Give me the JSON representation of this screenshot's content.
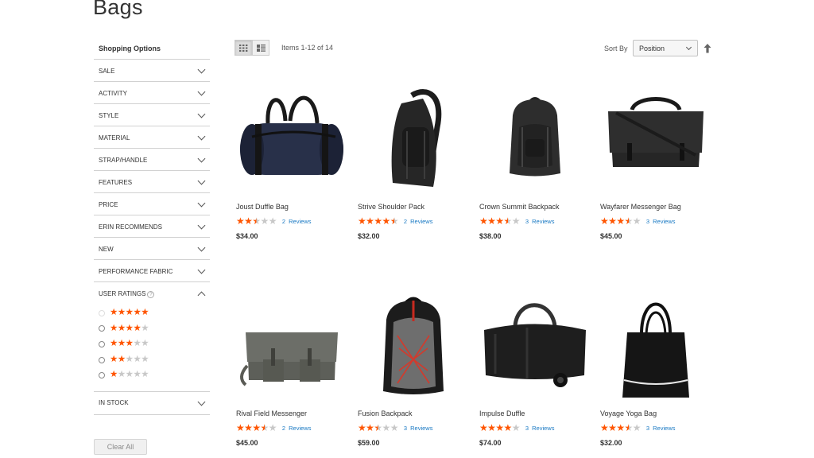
{
  "page": {
    "title": "Bags"
  },
  "sidebar": {
    "heading": "Shopping Options",
    "filters": [
      {
        "label": "SALE"
      },
      {
        "label": "ACTIVITY"
      },
      {
        "label": "STYLE"
      },
      {
        "label": "MATERIAL"
      },
      {
        "label": "STRAP/HANDLE"
      },
      {
        "label": "FEATURES"
      },
      {
        "label": "PRICE"
      },
      {
        "label": "ERIN RECOMMENDS"
      },
      {
        "label": "NEW"
      },
      {
        "label": "PERFORMANCE FABRIC"
      }
    ],
    "user_ratings": {
      "label": "USER RATINGS",
      "help_icon": "question-circle-icon",
      "options": [
        5,
        4,
        3,
        2,
        1
      ]
    },
    "in_stock": {
      "label": "IN STOCK"
    },
    "clear_all": "Clear All"
  },
  "toolbar": {
    "items_count": "Items 1-12 of 14",
    "sort_label": "Sort By",
    "sort_value": "Position",
    "grid_icon": "grid-view-icon",
    "list_icon": "list-view-icon",
    "sort_direction_icon": "arrow-up-icon"
  },
  "products": [
    {
      "name": "Joust Duffle Bag",
      "rating": 2.5,
      "reviews": "2  Reviews",
      "price": "$34.00",
      "image": "duffle-navy"
    },
    {
      "name": "Strive Shoulder Pack",
      "rating": 4.5,
      "reviews": "2  Reviews",
      "price": "$32.00",
      "image": "sling-pack"
    },
    {
      "name": "Crown Summit Backpack",
      "rating": 3.5,
      "reviews": "3  Reviews",
      "price": "$38.00",
      "image": "backpack-black"
    },
    {
      "name": "Wayfarer Messenger Bag",
      "rating": 3.5,
      "reviews": "3  Reviews",
      "price": "$45.00",
      "image": "messenger-black"
    },
    {
      "name": "Rival Field Messenger",
      "rating": 3.5,
      "reviews": "2  Reviews",
      "price": "$45.00",
      "image": "messenger-gray"
    },
    {
      "name": "Fusion Backpack",
      "rating": 2.5,
      "reviews": "3  Reviews",
      "price": "$59.00",
      "image": "backpack-gray"
    },
    {
      "name": "Impulse Duffle",
      "rating": 4,
      "reviews": "3  Reviews",
      "price": "$74.00",
      "image": "duffle-wheeled"
    },
    {
      "name": "Voyage Yoga Bag",
      "rating": 3.5,
      "reviews": "3  Reviews",
      "price": "$32.00",
      "image": "tote-black"
    }
  ],
  "colors": {
    "star_on": "#ff5501",
    "star_off": "#c8c8c8",
    "link": "#1979c3"
  }
}
